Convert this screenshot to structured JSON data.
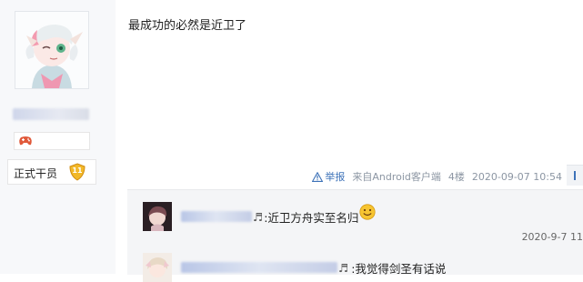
{
  "user_panel": {
    "rank_label": "正式干员",
    "level": "11"
  },
  "post": {
    "text": "最成功的必然是近卫了",
    "report_label": "举报",
    "source": "来自Android客户端",
    "floor": "4楼",
    "timestamp": "2020-09-07 10:54"
  },
  "replies": [
    {
      "text": ":近卫方舟实至名归",
      "timestamp": "2020-9-7 11"
    },
    {
      "text": ":我觉得剑圣有话说"
    }
  ]
}
